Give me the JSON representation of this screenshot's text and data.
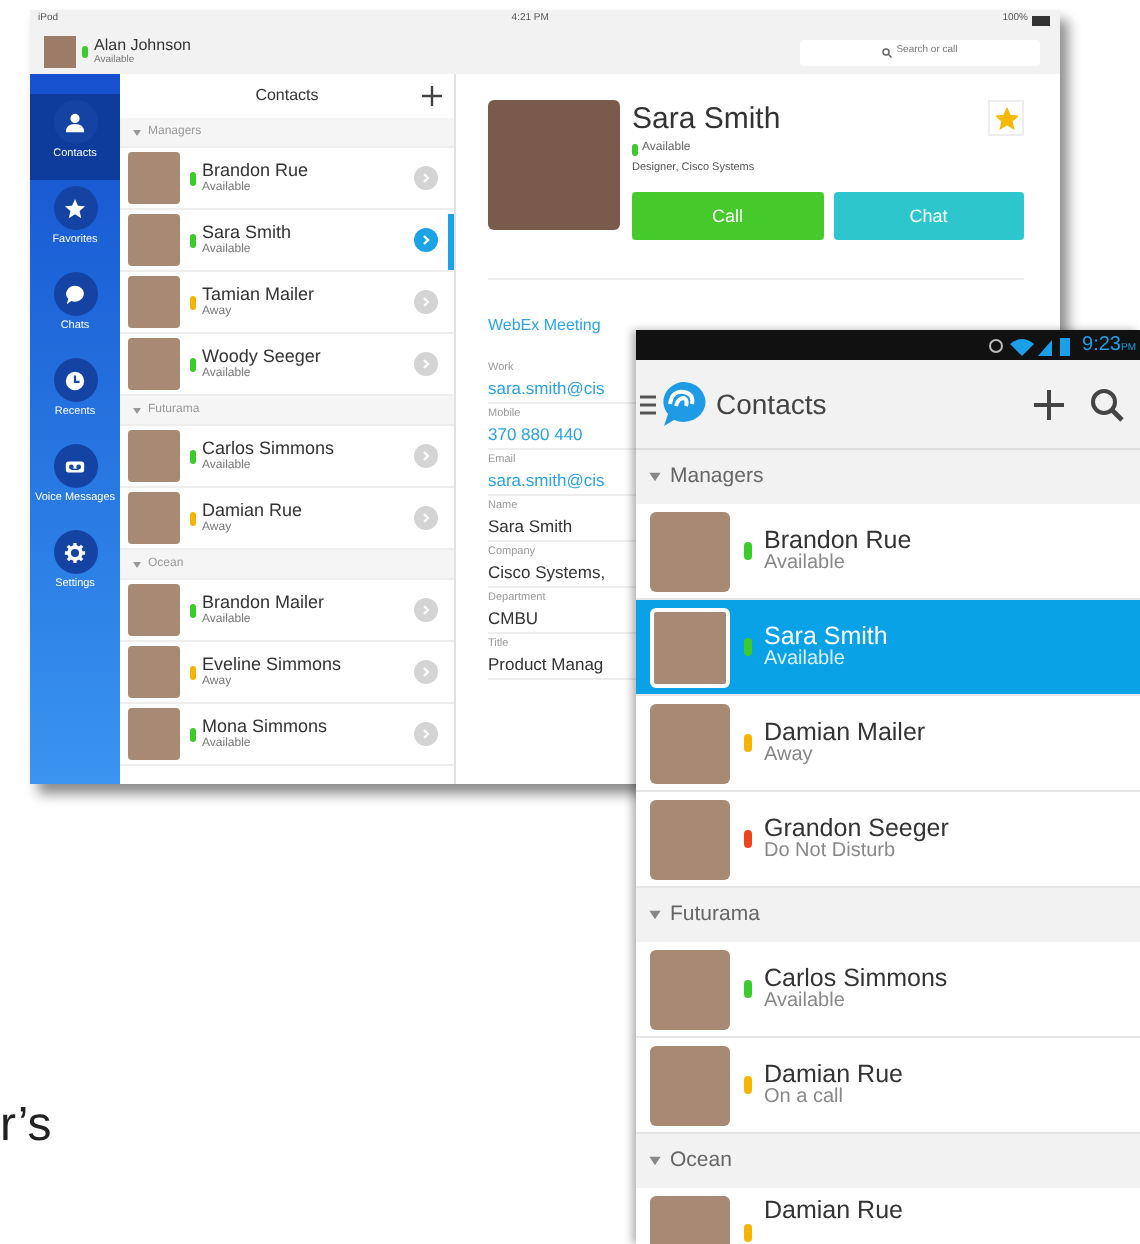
{
  "tablet": {
    "status_bar": {
      "device": "iPod",
      "time": "4:21 PM",
      "battery": "100%"
    },
    "user": {
      "name": "Alan Johnson",
      "status": "Available",
      "color": "#3ccb2c"
    },
    "search": {
      "placeholder": "Search or call"
    },
    "nav": [
      {
        "label": "Contacts",
        "kind": "person",
        "selected": true
      },
      {
        "label": "Favorites",
        "kind": "star",
        "selected": false
      },
      {
        "label": "Chats",
        "kind": "chat",
        "selected": false
      },
      {
        "label": "Recents",
        "kind": "clock",
        "selected": false
      },
      {
        "label": "Voice Messages",
        "kind": "voicemail",
        "selected": false
      },
      {
        "label": "Settings",
        "kind": "gear",
        "selected": false
      }
    ],
    "list_title": "Contacts",
    "groups": [
      {
        "name": "Managers",
        "expanded": true,
        "contacts": [
          {
            "name": "Brandon Rue",
            "status": "Available",
            "color": "#3ccb2c",
            "selected": false
          },
          {
            "name": "Sara Smith",
            "status": "Available",
            "color": "#3ccb2c",
            "selected": true
          },
          {
            "name": "Tamian Mailer",
            "status": "Away",
            "color": "#f5b400",
            "selected": false
          },
          {
            "name": "Woody Seeger",
            "status": "Available",
            "color": "#3ccb2c",
            "selected": false
          }
        ]
      },
      {
        "name": "Futurama",
        "expanded": true,
        "contacts": [
          {
            "name": "Carlos Simmons",
            "status": "Available",
            "color": "#3ccb2c",
            "selected": false
          },
          {
            "name": "Damian Rue",
            "status": "Away",
            "color": "#f5b400",
            "selected": false
          }
        ]
      },
      {
        "name": "Ocean",
        "expanded": true,
        "contacts": [
          {
            "name": "Brandon Mailer",
            "status": "Available",
            "color": "#3ccb2c",
            "selected": false
          },
          {
            "name": "Eveline Simmons",
            "status": "Away",
            "color": "#f5b400",
            "selected": false
          },
          {
            "name": "Mona Simmons",
            "status": "Available",
            "color": "#3ccb2c",
            "selected": false
          }
        ]
      }
    ],
    "detail": {
      "name": "Sara Smith",
      "status": "Available",
      "color": "#3ccb2c",
      "subtitle": "Designer, Cisco Systems",
      "favorite": true,
      "actions": [
        {
          "label": "Call",
          "kind": "call"
        },
        {
          "label": "Chat",
          "kind": "chat"
        }
      ],
      "link": "WebEx Meeting",
      "fields": [
        {
          "label": "Work",
          "value": "sara.smith@cis",
          "kind": "link"
        },
        {
          "label": "Mobile",
          "value": "370 880 440",
          "kind": "link"
        },
        {
          "label": "Email",
          "value": "sara.smith@cis",
          "kind": "link"
        },
        {
          "label": "Name",
          "value": "Sara Smith",
          "kind": "text"
        },
        {
          "label": "Company",
          "value": "Cisco Systems,",
          "kind": "text"
        },
        {
          "label": "Department",
          "value": "CMBU",
          "kind": "text"
        },
        {
          "label": "Title",
          "value": "Product Manag",
          "kind": "text"
        }
      ]
    }
  },
  "phone": {
    "status_bar": {
      "time": "9:23",
      "suffix": "PM"
    },
    "title": "Contacts",
    "groups": [
      {
        "name": "Managers",
        "expanded": true,
        "contacts": [
          {
            "name": "Brandon Rue",
            "status": "Available",
            "color": "#3ccb2c",
            "selected": false
          },
          {
            "name": "Sara Smith",
            "status": "Available",
            "color": "#3ccb2c",
            "selected": true
          },
          {
            "name": "Damian Mailer",
            "status": "Away",
            "color": "#f5b400",
            "selected": false
          },
          {
            "name": "Grandon Seeger",
            "status": "Do Not Disturb",
            "color": "#f0441c",
            "selected": false
          }
        ]
      },
      {
        "name": "Futurama",
        "expanded": true,
        "contacts": [
          {
            "name": "Carlos Simmons",
            "status": "Available",
            "color": "#3ccb2c",
            "selected": false
          },
          {
            "name": "Damian Rue",
            "status": "On a call",
            "color": "#f5b400",
            "selected": false
          }
        ]
      },
      {
        "name": "Ocean",
        "expanded": true,
        "contacts": [
          {
            "name": "Damian Rue",
            "color": "#f5b400",
            "selected": false
          }
        ]
      }
    ]
  },
  "slide_text": "r’s"
}
